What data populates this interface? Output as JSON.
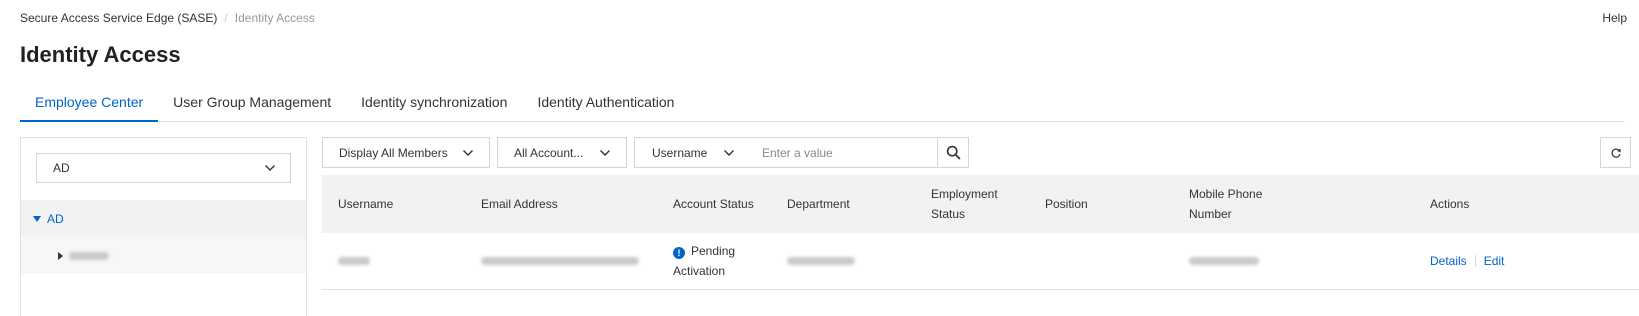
{
  "breadcrumb": {
    "parent": "Secure Access Service Edge (SASE)",
    "separator": "/",
    "current": "Identity Access"
  },
  "help_label": "Help",
  "page_title": "Identity Access",
  "tabs": [
    {
      "label": "Employee Center",
      "active": true
    },
    {
      "label": "User Group Management",
      "active": false
    },
    {
      "label": "Identity synchronization",
      "active": false
    },
    {
      "label": "Identity Authentication",
      "active": false
    }
  ],
  "left_panel": {
    "directory_select": {
      "value": "AD",
      "icon": "chevron-down-icon"
    },
    "tree": {
      "root_label": "AD",
      "root_icon": "caret-down-icon",
      "child_icon": "caret-right-icon"
    }
  },
  "filters": {
    "member_select": {
      "value": "Display All Members",
      "icon": "chevron-down-icon"
    },
    "account_select": {
      "value": "All Account...",
      "icon": "chevron-down-icon"
    },
    "search_field_select": {
      "value": "Username",
      "icon": "chevron-down-icon"
    },
    "search_input": {
      "placeholder": "Enter a value",
      "value": ""
    },
    "search_button_icon": "search-icon",
    "refresh_button_icon": "refresh-icon"
  },
  "table": {
    "headers": {
      "username": "Username",
      "email": "Email Address",
      "account_status": "Account Status",
      "department": "Department",
      "employment_status_line1": "Employment",
      "employment_status_line2": "Status",
      "position": "Position",
      "mobile_line1": "Mobile Phone",
      "mobile_line2": "Number",
      "actions": "Actions"
    },
    "rows": [
      {
        "account_status_line1": "Pending",
        "account_status_line2": "Activation",
        "status_icon": "info-icon",
        "status_color": "#0064c8",
        "actions": {
          "details": "Details",
          "edit": "Edit"
        }
      }
    ]
  },
  "colors": {
    "accent": "#0064c8",
    "header_bg": "#f2f2f2",
    "border": "#e3e3e3"
  }
}
